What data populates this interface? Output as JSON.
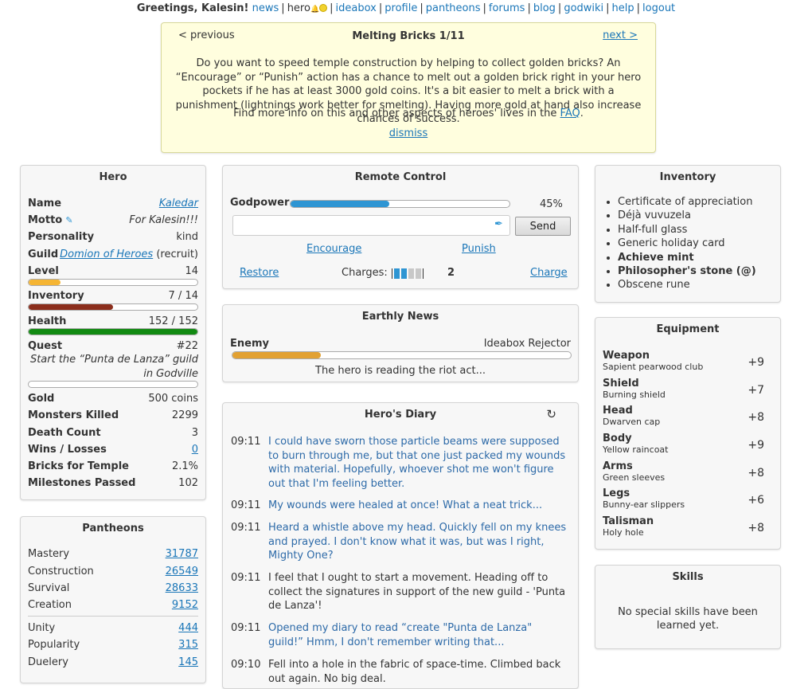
{
  "topnav": {
    "greeting": "Greetings, Kalesin!",
    "links": [
      "news",
      "hero",
      "ideabox",
      "profile",
      "pantheons",
      "forums",
      "blog",
      "godwiki",
      "help",
      "logout"
    ]
  },
  "notice": {
    "prev": "< previous",
    "title": "Melting Bricks 1/11",
    "next": "next >",
    "text": "Do you want to speed temple construction by helping to collect golden bricks? An “Encourage” or “Punish” action has a chance to melt out a golden brick right in your hero pockets if he has at least 3000 gold coins. It's a bit easier to melt a brick with a punishment (lightnings work better for smelting). Having more gold at hand also increase chances of success.",
    "more_prefix": "Find more info on this and other aspects of heroes' lives in the ",
    "faq": "FAQ",
    "more_suffix": ".",
    "dismiss": "dismiss"
  },
  "hero": {
    "title": "Hero",
    "name_label": "Name",
    "name": "Kaledar",
    "motto_label": "Motto",
    "motto": "For Kalesin!!!",
    "personality_label": "Personality",
    "personality": "kind",
    "guild_label": "Guild",
    "guild": "Domion of Heroes",
    "guild_rank": "(recruit)",
    "level_label": "Level",
    "level": "14",
    "level_progress": 0.19,
    "inventory_label": "Inventory",
    "inventory": "7 / 14",
    "inventory_progress": 0.5,
    "health_label": "Health",
    "health": "152 / 152",
    "health_progress": 1.0,
    "quest_label": "Quest",
    "quest_num": "#22",
    "quest_text_1": "Start the “Punta de Lanza” guild",
    "quest_text_2": "in Godville",
    "quest_progress": 0.0,
    "gold_label": "Gold",
    "gold": "500 coins",
    "monsters_label": "Monsters Killed",
    "monsters": "2299",
    "death_label": "Death Count",
    "death": "3",
    "wins_label": "Wins / Losses",
    "wins": "0",
    "bricks_label": "Bricks for Temple",
    "bricks": "2.1%",
    "milestones_label": "Milestones Passed",
    "milestones": "102",
    "colors": {
      "level": "#f5b534",
      "inventory": "#8b2e1c",
      "health": "#128a12"
    }
  },
  "pantheons": {
    "title": "Pantheons",
    "group1": [
      {
        "name": "Mastery",
        "value": "31787"
      },
      {
        "name": "Construction",
        "value": "26549"
      },
      {
        "name": "Survival",
        "value": "28633"
      },
      {
        "name": "Creation",
        "value": "9152"
      }
    ],
    "group2": [
      {
        "name": "Unity",
        "value": "444"
      },
      {
        "name": "Popularity",
        "value": "315"
      },
      {
        "name": "Duelery",
        "value": "145"
      }
    ]
  },
  "remote": {
    "title": "Remote Control",
    "godpower_label": "Godpower",
    "godpower_pct": "45%",
    "godpower_value": 0.45,
    "input_value": "",
    "send": "Send",
    "encourage": "Encourage",
    "punish": "Punish",
    "restore": "Restore",
    "charges_label": "Charges:",
    "charges_count": "2",
    "charge": "Charge",
    "accent": "#2e95d3"
  },
  "news": {
    "title": "Earthly News",
    "enemy_label": "Enemy",
    "enemy_name": "Ideabox Rejector",
    "enemy_progress": 0.26,
    "text": "The hero is reading the riot act..."
  },
  "diary": {
    "title": "Hero's Diary",
    "entries": [
      {
        "time": "09:11",
        "text": "I could have sworn those particle beams were supposed to burn through me, but that one just packed my wounds with material. Hopefully, whoever shot me won't figure out that I'm feeling better.",
        "god": true
      },
      {
        "time": "09:11",
        "text": "My wounds were healed at once! What a neat trick...",
        "god": true
      },
      {
        "time": "09:11",
        "text": "Heard a whistle above my head. Quickly fell on my knees and prayed. I don't know what it was, but was I right, Mighty One?",
        "god": true
      },
      {
        "time": "09:11",
        "text": "I feel that I ought to start a movement. Heading off to collect the signatures in support of the new guild - 'Punta de Lanza'!",
        "god": false
      },
      {
        "time": "09:11",
        "text": "Opened my diary to read “create \"Punta de Lanza\" guild!” Hmm, I don't remember writing that...",
        "god": true
      },
      {
        "time": "09:10",
        "text": "Fell into a hole in the fabric of space-time. Climbed back out again. No big deal.",
        "god": false
      }
    ]
  },
  "inventory": {
    "title": "Inventory",
    "items": [
      {
        "name": "Certificate of appreciation",
        "bold": false
      },
      {
        "name": "Déjà vuvuzela",
        "bold": false
      },
      {
        "name": "Half-full glass",
        "bold": false
      },
      {
        "name": "Generic holiday card",
        "bold": false
      },
      {
        "name": "Achieve mint",
        "bold": true
      },
      {
        "name": "Philosopher's stone (@)",
        "bold": true
      },
      {
        "name": "Obscene rune",
        "bold": false
      }
    ]
  },
  "equipment": {
    "title": "Equipment",
    "items": [
      {
        "slot": "Weapon",
        "item": "Sapient pearwood club",
        "bonus": "+9"
      },
      {
        "slot": "Shield",
        "item": "Burning shield",
        "bonus": "+7"
      },
      {
        "slot": "Head",
        "item": "Dwarven cap",
        "bonus": "+8"
      },
      {
        "slot": "Body",
        "item": "Yellow raincoat",
        "bonus": "+9"
      },
      {
        "slot": "Arms",
        "item": "Green sleeves",
        "bonus": "+8"
      },
      {
        "slot": "Legs",
        "item": "Bunny-ear slippers",
        "bonus": "+6"
      },
      {
        "slot": "Talisman",
        "item": "Holy hole",
        "bonus": "+8"
      }
    ]
  },
  "skills": {
    "title": "Skills",
    "text": "No special skills have been learned yet."
  }
}
